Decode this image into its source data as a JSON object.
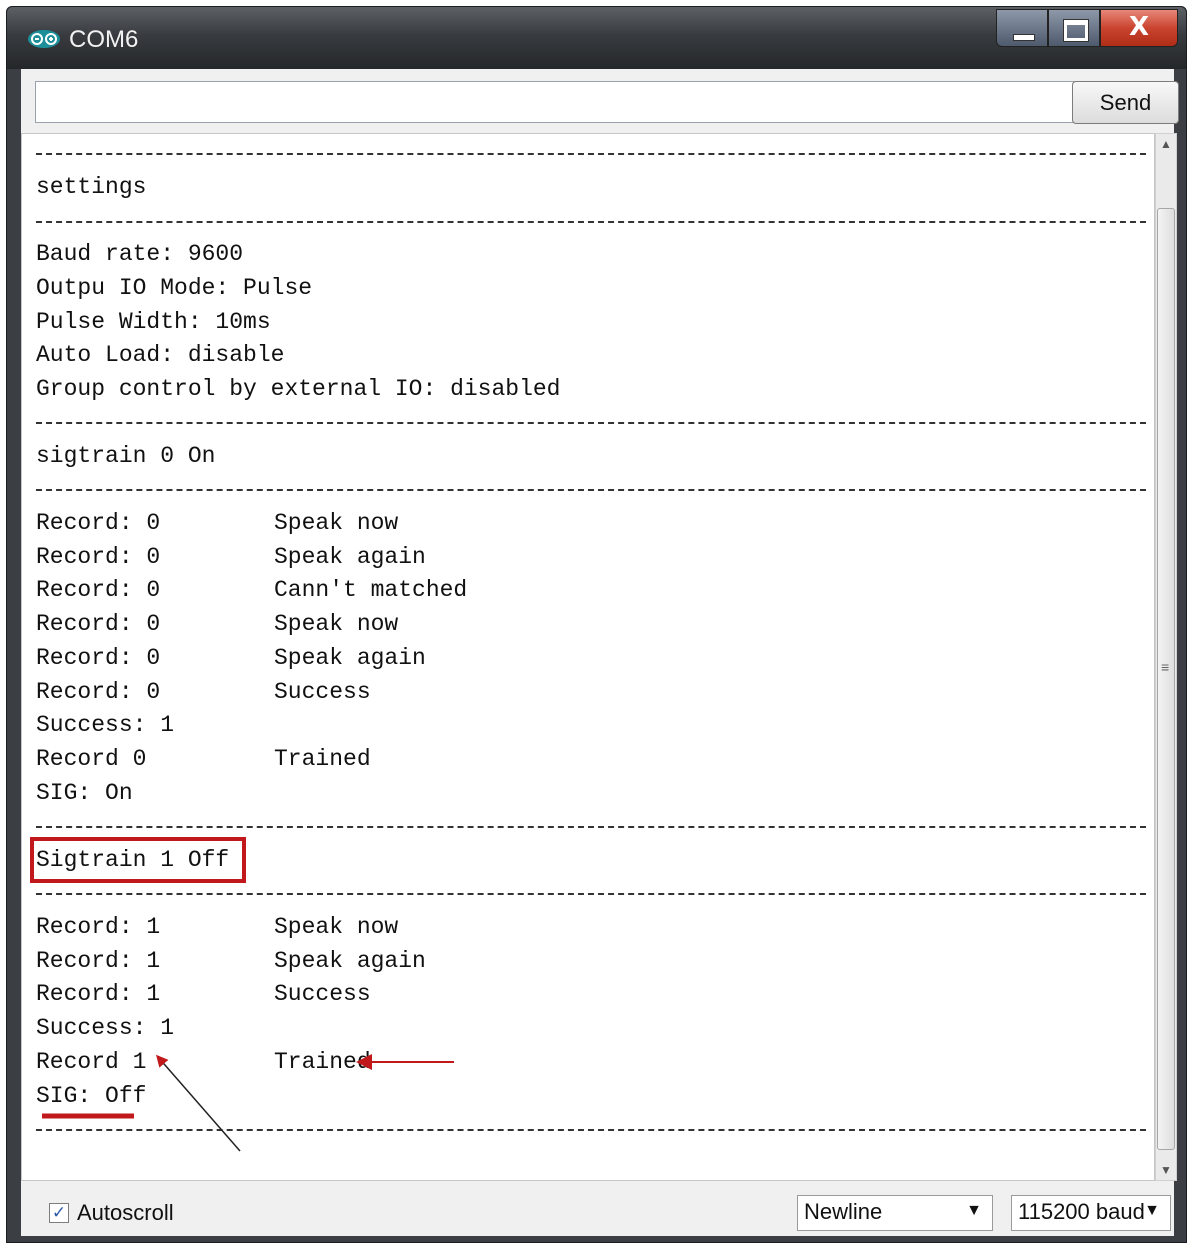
{
  "window": {
    "title": "COM6",
    "close_glyph": "X"
  },
  "input": {
    "value": "",
    "placeholder": ""
  },
  "toolbar": {
    "send_label": "Send"
  },
  "output": {
    "line_settings": "settings",
    "line_baud": "Baud rate: 9600",
    "line_mode": "Outpu IO Mode: Pulse",
    "line_pulse": "Pulse Width: 10ms",
    "line_autoload": "Auto Load: disable",
    "line_group": "Group control by external IO: disabled",
    "line_sigtrain0": "sigtrain 0 On",
    "block1": [
      {
        "left": "Record: 0",
        "right": "Speak now"
      },
      {
        "left": "Record: 0",
        "right": "Speak again"
      },
      {
        "left": "Record: 0",
        "right": "Cann't matched"
      },
      {
        "left": "Record: 0",
        "right": "Speak now"
      },
      {
        "left": "Record: 0",
        "right": "Speak again"
      },
      {
        "left": "Record: 0",
        "right": "Success"
      },
      {
        "left": "Success: 1",
        "right": ""
      },
      {
        "left": "Record 0",
        "right": "Trained"
      },
      {
        "left": "SIG: On",
        "right": ""
      }
    ],
    "line_sigtrain1": "Sigtrain 1 Off",
    "block2": [
      {
        "left": "Record: 1",
        "right": "Speak now"
      },
      {
        "left": "Record: 1",
        "right": "Speak again"
      },
      {
        "left": "Record: 1",
        "right": "Success"
      },
      {
        "left": "Success: 1",
        "right": ""
      },
      {
        "left": "Record 1",
        "right": "Trained"
      },
      {
        "left": "SIG: Off",
        "right": ""
      }
    ]
  },
  "status_bar": {
    "autoscroll_label": "Autoscroll",
    "autoscroll_checked": true,
    "line_ending": "Newline",
    "baud": "115200 baud"
  },
  "colors": {
    "annotation": "#c0181b",
    "titlebar": "#2e3135"
  }
}
